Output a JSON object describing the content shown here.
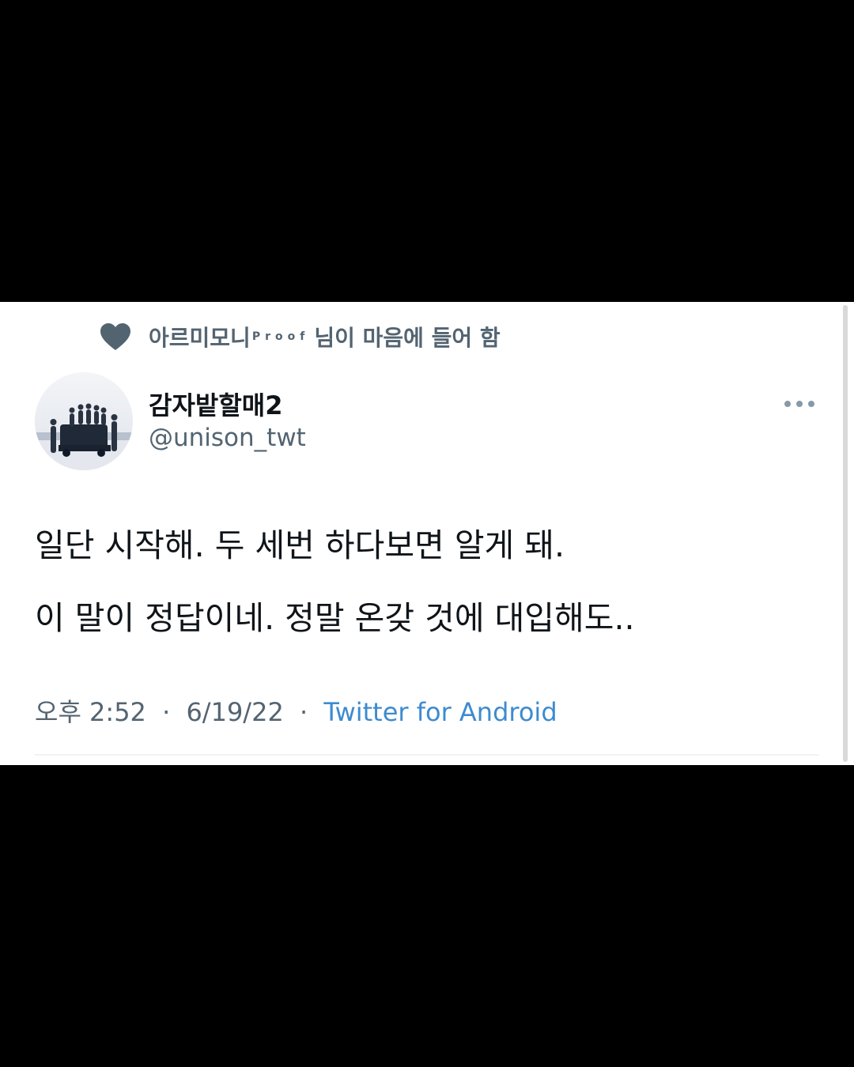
{
  "social_context": {
    "liked_user": "아르미모니",
    "liked_user_sup": "Proof",
    "liked_suffix": "님이 마음에 들어 함",
    "icon": "heart-icon"
  },
  "author": {
    "display_name": "감자밭할매2",
    "handle": "@unison_twt",
    "avatar_icon": "avatar"
  },
  "more_icon": "more-dots-icon",
  "tweet": {
    "lines": [
      "일단 시작해. 두 세번 하다보면 알게 돼.",
      "이 말이 정답이네. 정말 온갖 것에 대입해도.."
    ]
  },
  "meta": {
    "time": "오후 2:52",
    "separator": "·",
    "date": "6/19/22",
    "source": "Twitter for Android"
  },
  "colors": {
    "background": "#000000",
    "card": "#ffffff",
    "text_primary": "#0f1419",
    "text_secondary": "#536471",
    "link": "#3d8bd0"
  }
}
